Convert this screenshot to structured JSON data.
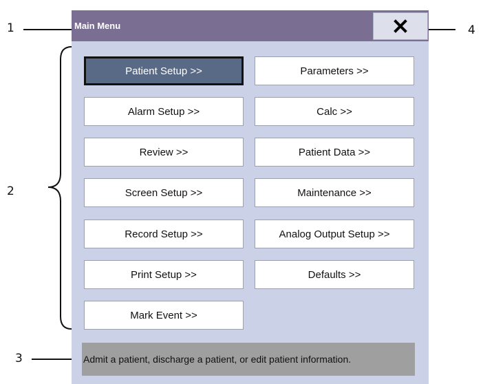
{
  "callouts": [
    "1",
    "2",
    "3",
    "4"
  ],
  "window": {
    "title": "Main Menu",
    "close_symbol": "×",
    "close_icon": "close-icon"
  },
  "menu": {
    "items": [
      {
        "label": "Patient Setup >>",
        "selected": true
      },
      {
        "label": "Parameters >>"
      },
      {
        "label": "Alarm Setup >>"
      },
      {
        "label": "Calc >>"
      },
      {
        "label": "Review >>"
      },
      {
        "label": "Patient Data >>"
      },
      {
        "label": "Screen Setup >>"
      },
      {
        "label": "Maintenance >>"
      },
      {
        "label": "Record Setup >>"
      },
      {
        "label": "Analog Output Setup >>"
      },
      {
        "label": "Print Setup >>"
      },
      {
        "label": "Defaults >>"
      },
      {
        "label": "Mark Event >>"
      }
    ]
  },
  "help": {
    "text": "Admit a patient, discharge a patient, or edit patient information."
  },
  "colors": {
    "titlebar": "#7a6f93",
    "panel": "#cbd1e6",
    "selected_button": "#596a86",
    "help_bar": "#9f9fa0"
  }
}
